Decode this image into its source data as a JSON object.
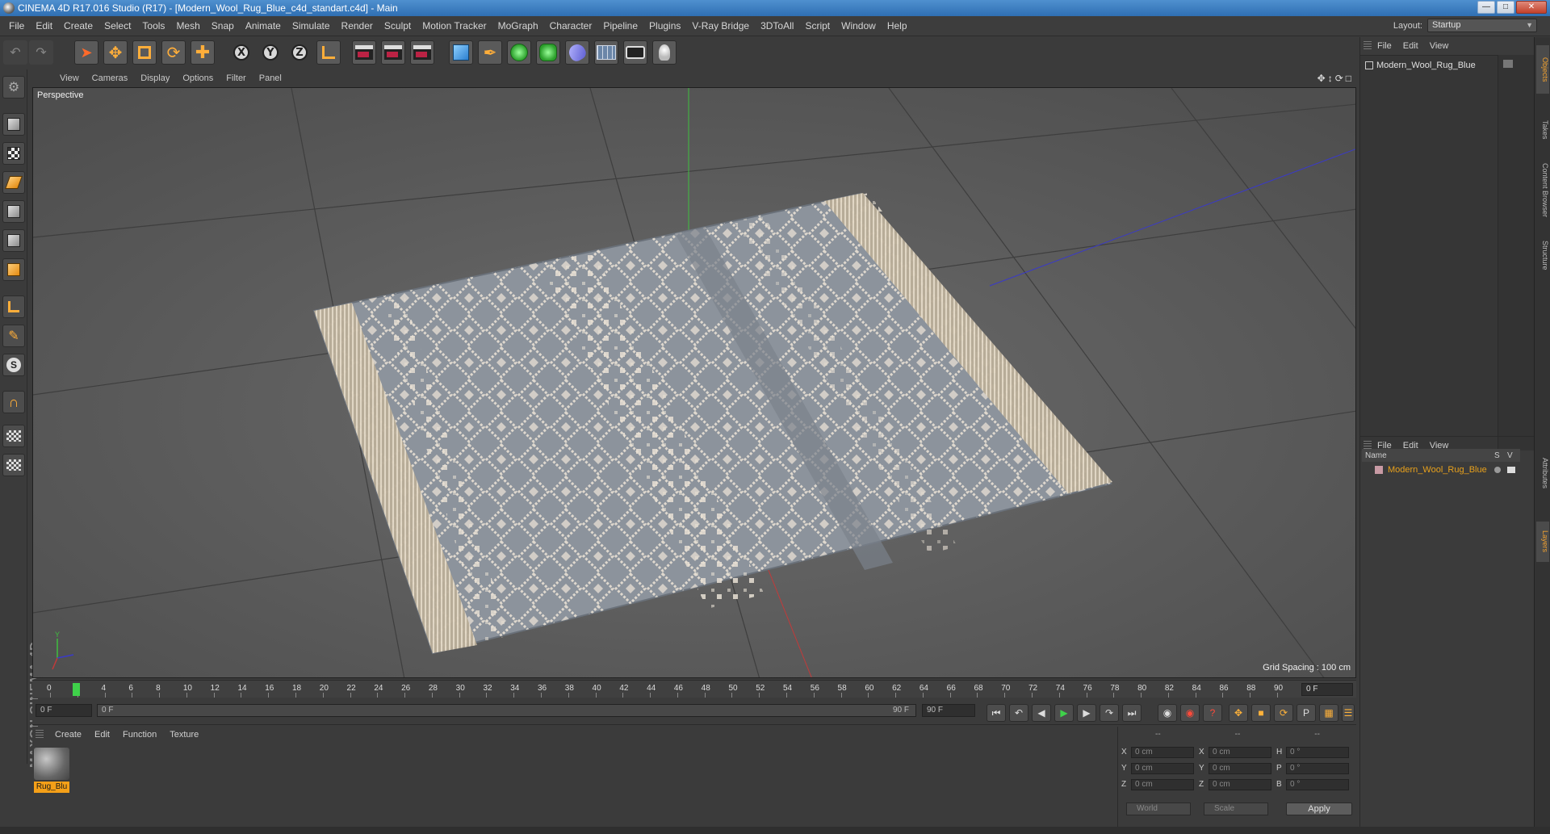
{
  "window": {
    "title": "CINEMA 4D R17.016 Studio (R17) - [Modern_Wool_Rug_Blue_c4d_standart.c4d] - Main"
  },
  "menubar": {
    "items": [
      "File",
      "Edit",
      "Create",
      "Select",
      "Tools",
      "Mesh",
      "Snap",
      "Animate",
      "Simulate",
      "Render",
      "Sculpt",
      "Motion Tracker",
      "MoGraph",
      "Character",
      "Pipeline",
      "Plugins",
      "V-Ray Bridge",
      "3DToAll",
      "Script",
      "Window",
      "Help"
    ],
    "layout_label": "Layout:",
    "layout_value": "Startup"
  },
  "toolbar": {
    "axis_x": "X",
    "axis_y": "Y",
    "axis_z": "Z"
  },
  "viewport": {
    "menu": [
      "View",
      "Cameras",
      "Display",
      "Options",
      "Filter",
      "Panel"
    ],
    "label": "Perspective",
    "grid_spacing": "Grid Spacing : 100 cm"
  },
  "object_manager": {
    "menu": [
      "File",
      "Edit",
      "View"
    ],
    "object_name": "Modern_Wool_Rug_Blue"
  },
  "layer_manager": {
    "menu": [
      "File",
      "Edit",
      "View"
    ],
    "col_name": "Name",
    "col_s": "S",
    "col_v": "V",
    "layer_name": "Modern_Wool_Rug_Blue",
    "layer_color": "#e8a11c"
  },
  "side_tabs": [
    "Objects",
    "Takes",
    "Content Browser",
    "Structure",
    "Attributes",
    "Layers"
  ],
  "timeline": {
    "ticks": [
      "0",
      "2",
      "4",
      "6",
      "8",
      "10",
      "12",
      "14",
      "16",
      "18",
      "20",
      "22",
      "24",
      "26",
      "28",
      "30",
      "32",
      "34",
      "36",
      "38",
      "40",
      "42",
      "44",
      "46",
      "48",
      "50",
      "52",
      "54",
      "56",
      "58",
      "60",
      "62",
      "64",
      "66",
      "68",
      "70",
      "72",
      "74",
      "76",
      "78",
      "80",
      "82",
      "84",
      "86",
      "88",
      "90"
    ],
    "end_field": "0 F"
  },
  "transport": {
    "current_frame": "0 F",
    "range_start": "0 F",
    "range_end": "90 F",
    "max_frame": "90 F"
  },
  "material_manager": {
    "menu": [
      "Create",
      "Edit",
      "Function",
      "Texture"
    ],
    "material_name": "Rug_Blu"
  },
  "coordinates": {
    "header": [
      "--",
      "--",
      "--"
    ],
    "rows": [
      {
        "a_label": "X",
        "a_val": "0 cm",
        "b_label": "X",
        "b_val": "0 cm",
        "c_label": "H",
        "c_val": "0 °"
      },
      {
        "a_label": "Y",
        "a_val": "0 cm",
        "b_label": "Y",
        "b_val": "0 cm",
        "c_label": "P",
        "c_val": "0 °"
      },
      {
        "a_label": "Z",
        "a_val": "0 cm",
        "b_label": "Z",
        "b_val": "0 cm",
        "c_label": "B",
        "c_val": "0 °"
      }
    ],
    "mode_world": "World",
    "mode_scale": "Scale",
    "apply_label": "Apply"
  },
  "logo": "MAXON CINEMA 4D",
  "colors": {
    "accent": "#f5a018",
    "playhead": "#3fd14a",
    "rug_base": "#8c939c",
    "rug_pattern": "#e8e0d4"
  }
}
